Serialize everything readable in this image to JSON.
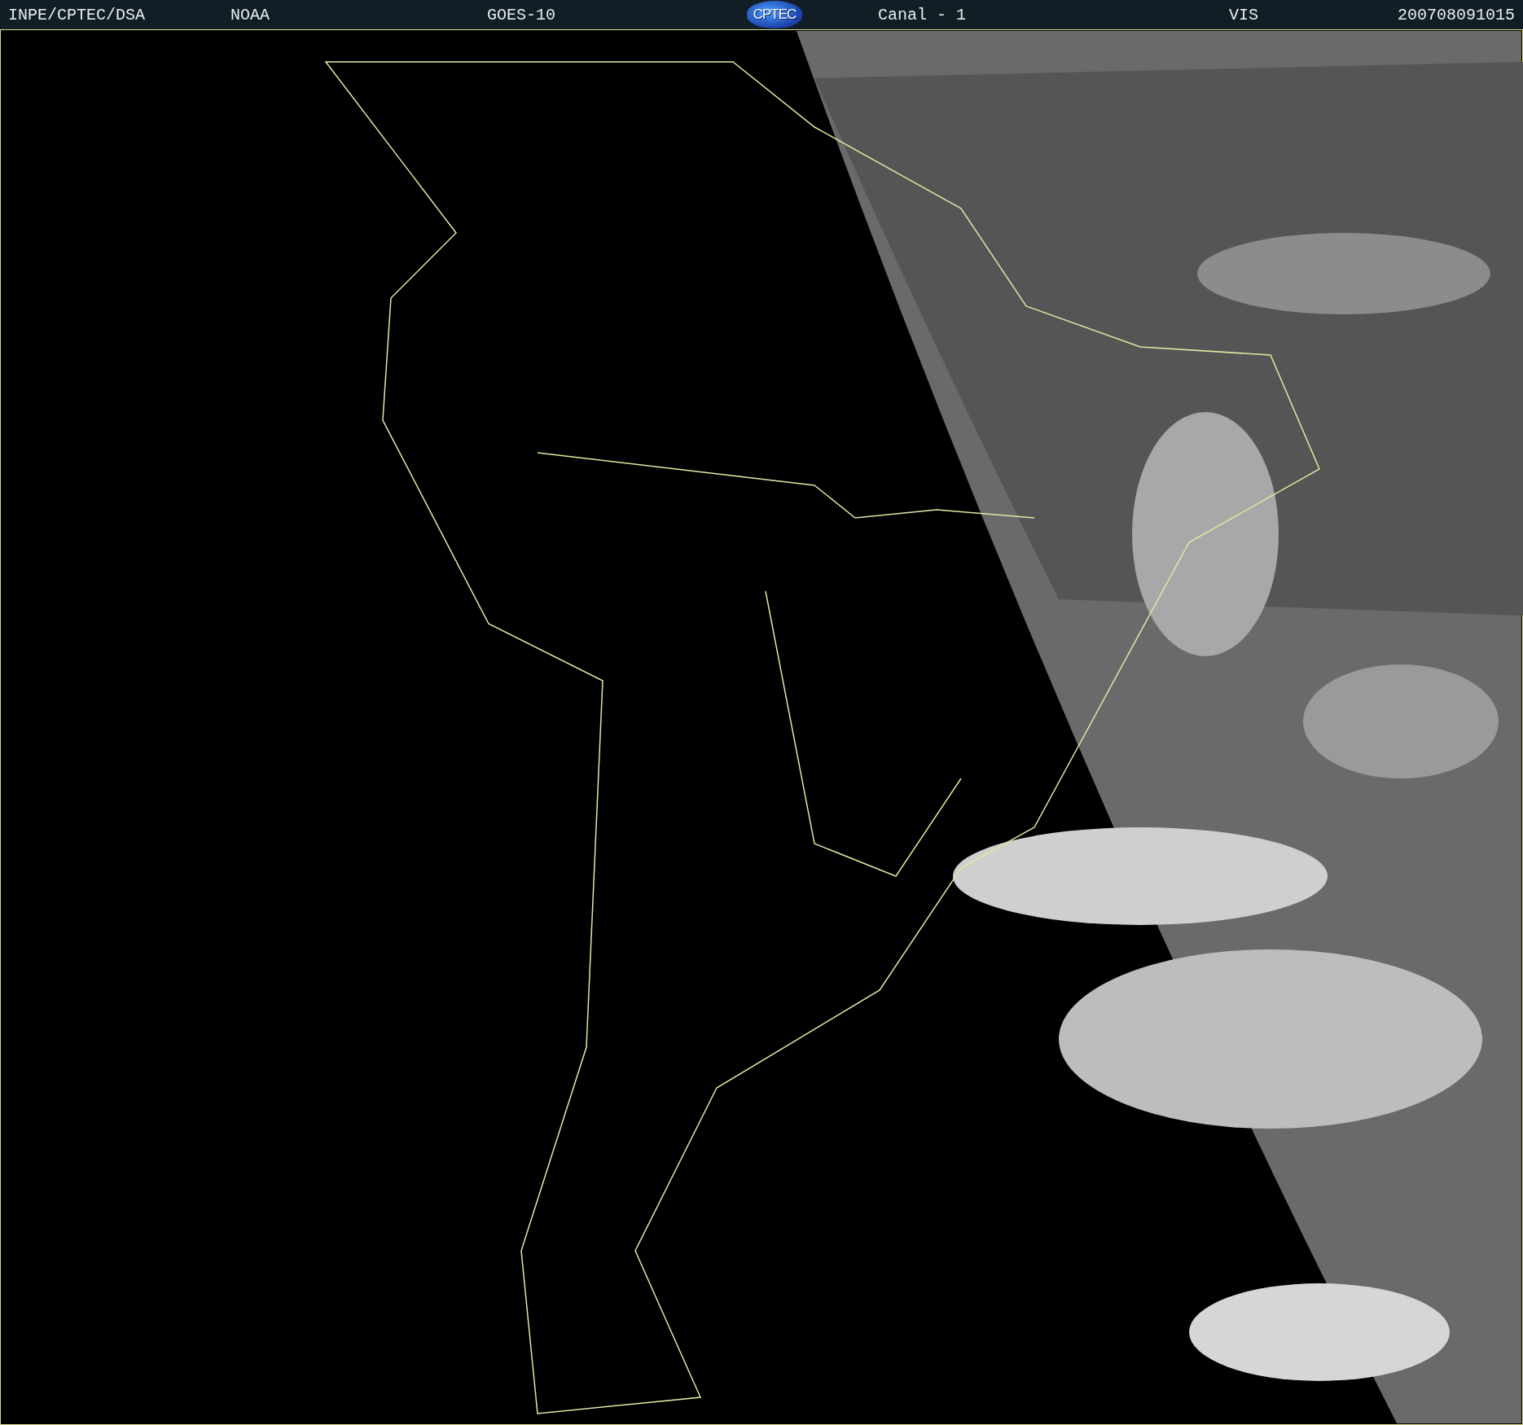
{
  "header": {
    "agency": "INPE/CPTEC/DSA",
    "source": "NOAA",
    "satellite": "GOES-10",
    "logo": "CPTEC",
    "channel": "Canal - 1",
    "band": "VIS",
    "timestamp": "200708091015"
  }
}
